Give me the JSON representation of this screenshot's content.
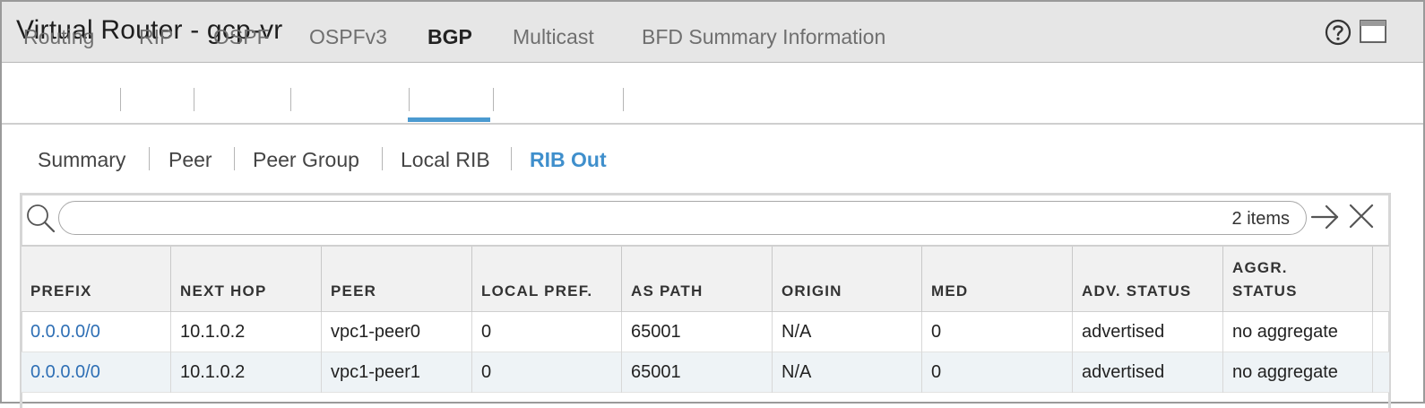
{
  "window": {
    "title": "Virtual Router - gcp-vr"
  },
  "main_tabs": [
    {
      "label": "Routing",
      "active": false
    },
    {
      "label": "RIP",
      "active": false
    },
    {
      "label": "OSPF",
      "active": false
    },
    {
      "label": "OSPFv3",
      "active": false
    },
    {
      "label": "BGP",
      "active": true
    },
    {
      "label": "Multicast",
      "active": false
    },
    {
      "label": "BFD Summary Information",
      "active": false
    }
  ],
  "sub_tabs": [
    {
      "label": "Summary",
      "active": false
    },
    {
      "label": "Peer",
      "active": false
    },
    {
      "label": "Peer Group",
      "active": false
    },
    {
      "label": "Local RIB",
      "active": false
    },
    {
      "label": "RIB Out",
      "active": true
    }
  ],
  "filter": {
    "placeholder": "",
    "value": "",
    "item_count": "2 items"
  },
  "table": {
    "columns": [
      "PREFIX",
      "NEXT HOP",
      "PEER",
      "LOCAL PREF.",
      "AS PATH",
      "ORIGIN",
      "MED",
      "ADV. STATUS",
      "AGGR.\nSTATUS"
    ],
    "rows": [
      [
        "0.0.0.0/0",
        "10.1.0.2",
        "vpc1-peer0",
        "0",
        "65001",
        "N/A",
        "0",
        "advertised",
        "no aggregate"
      ],
      [
        "0.0.0.0/0",
        "10.1.0.2",
        "vpc1-peer1",
        "0",
        "65001",
        "N/A",
        "0",
        "advertised",
        "no aggregate"
      ]
    ]
  },
  "icons": {
    "help": "help-icon",
    "restore": "restore-window-icon",
    "search": "search-icon",
    "apply": "arrow-right-icon",
    "clear": "close-icon"
  },
  "colors": {
    "accent": "#4b9ad0",
    "active_subtab": "#3f8fcc",
    "link": "#2e6fb5",
    "titlebar_bg": "#e6e6e6",
    "header_bg": "#f1f1f1",
    "alt_row_bg": "#eef3f6"
  }
}
